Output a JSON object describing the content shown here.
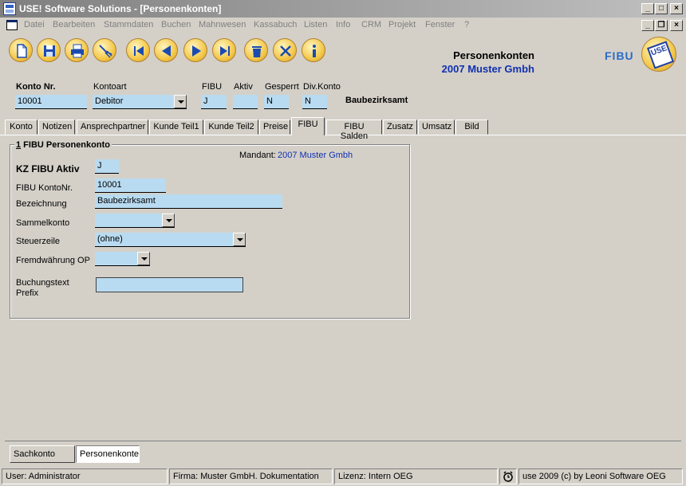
{
  "window": {
    "title": "USE! Software Solutions - [Personenkonten]"
  },
  "menu": [
    "Datei",
    "Bearbeiten",
    "Stammdaten",
    "Buchen",
    "Mahnwesen",
    "Kassabuch",
    "Listen",
    "Info",
    "CRM",
    "Projekt",
    "Fenster",
    "?"
  ],
  "header": {
    "title": "Personenkonten",
    "subtitle": "2007 Muster Gmbh",
    "module": "FIBU",
    "logo_text": "USE"
  },
  "account": {
    "konto_label": "Konto Nr.",
    "konto_value": "10001",
    "kontoart_label": "Kontoart",
    "kontoart_value": "Debitor",
    "fibu_label": "FIBU",
    "fibu_value": "J",
    "aktiv_label": "Aktiv",
    "aktiv_value": "",
    "gesperrt_label": "Gesperrt",
    "gesperrt_value": "N",
    "divkonto_label": "Div.Konto",
    "divkonto_value": "N",
    "name": "Baubezirksamt"
  },
  "tabs": [
    "Konto",
    "Notizen",
    "Ansprechpartner",
    "Kunde Teil1",
    "Kunde Teil2",
    "Preise",
    "FIBU",
    "FIBU Salden",
    "Zusatz",
    "Umsatz",
    "Bild"
  ],
  "group": {
    "number": "1",
    "title": " FIBU Personenkonto",
    "mandant_label": "Mandant:",
    "mandant_value": "2007 Muster Gmbh",
    "kz_label": "KZ FIBU Aktiv",
    "kz_value": "J",
    "kontonr_label": "FIBU KontoNr.",
    "kontonr_value": "10001",
    "bez_label": "Bezeichnung",
    "bez_value": "Baubezirksamt",
    "sammel_label": "Sammelkonto",
    "sammel_value": "",
    "steuer_label": "Steuerzeile",
    "steuer_value": "(ohne)",
    "fremd_label": "Fremdwährung OP",
    "fremd_value": "",
    "buch_label_1": "Buchungstext",
    "buch_label_2": "Prefix",
    "buch_value": ""
  },
  "bottom_tabs": [
    "Sachkonto",
    "Personenkonter"
  ],
  "status": {
    "user": "User: Administrator",
    "firma": "Firma: Muster GmbH. Dokumentation",
    "lizenz": "Lizenz: Intern OEG",
    "copyright": "use 2009 (c) by Leoni Software OEG"
  },
  "colors": {
    "field_bg": "#b9dbf1",
    "accent_blue": "#1030b0",
    "face": "#d4d0c8"
  }
}
